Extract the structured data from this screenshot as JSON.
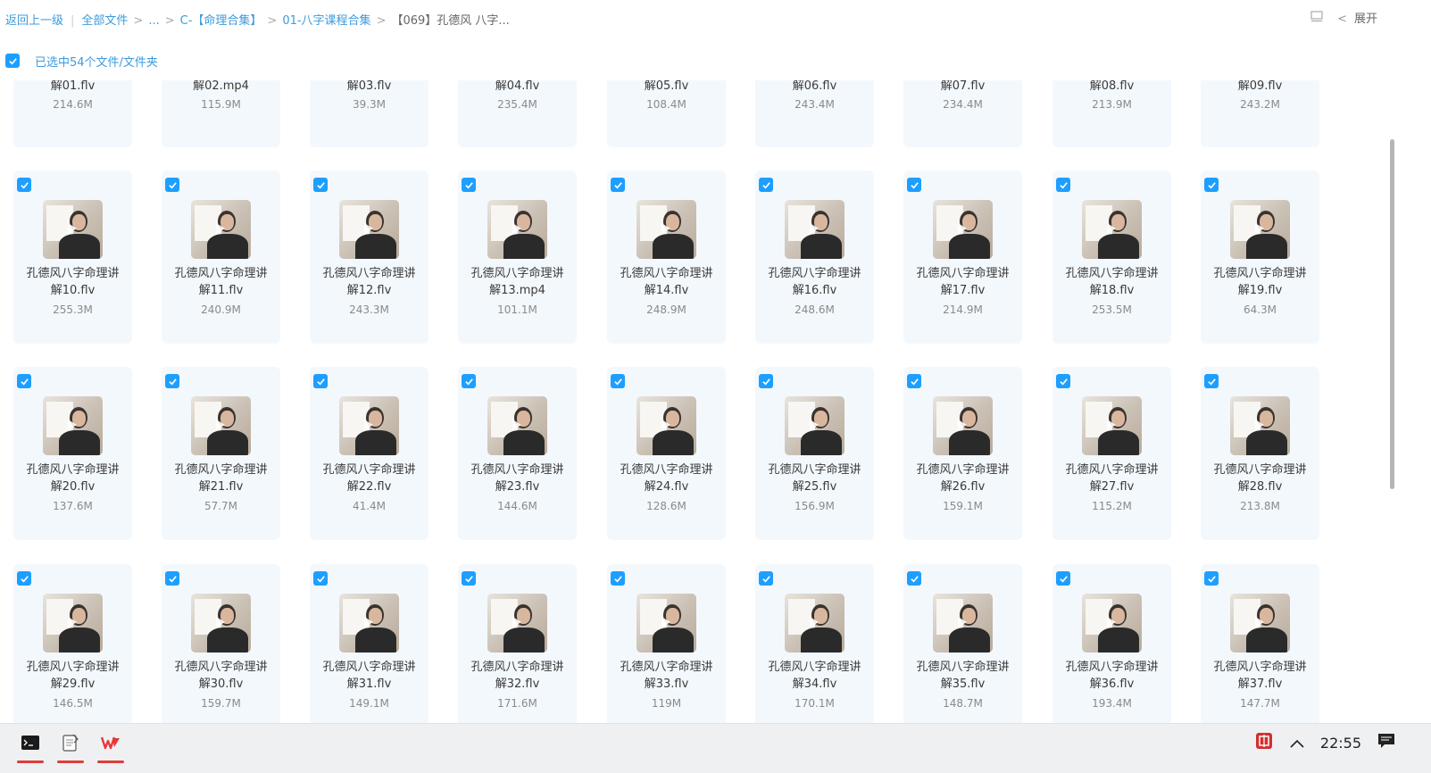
{
  "breadcrumb": {
    "back": "返回上一级",
    "all_files": "全部文件",
    "ellipsis": "...",
    "folder1": "C-【命理合集】",
    "folder2": "01-八字课程合集",
    "current": "【069】孔德风 八字..."
  },
  "header": {
    "expand_label": "展开"
  },
  "selection": {
    "text": "已选中54个文件/文件夹"
  },
  "colors": {
    "accent": "#1e9fff",
    "link": "#3d9bdc",
    "tile_bg": "#f3f8fd",
    "taskbar_bg": "#eff0f2"
  },
  "top_row": [
    {
      "name": "解01.flv",
      "size": "214.6M"
    },
    {
      "name": "解02.mp4",
      "size": "115.9M"
    },
    {
      "name": "解03.flv",
      "size": "39.3M"
    },
    {
      "name": "解04.flv",
      "size": "235.4M"
    },
    {
      "name": "解05.flv",
      "size": "108.4M"
    },
    {
      "name": "解06.flv",
      "size": "243.4M"
    },
    {
      "name": "解07.flv",
      "size": "234.4M"
    },
    {
      "name": "解08.flv",
      "size": "213.9M"
    },
    {
      "name": "解09.flv",
      "size": "243.2M"
    }
  ],
  "file_prefix": "孔德风八字命理讲",
  "rows": [
    [
      {
        "name": "解10.flv",
        "size": "255.3M"
      },
      {
        "name": "解11.flv",
        "size": "240.9M"
      },
      {
        "name": "解12.flv",
        "size": "243.3M"
      },
      {
        "name": "解13.mp4",
        "size": "101.1M"
      },
      {
        "name": "解14.flv",
        "size": "248.9M"
      },
      {
        "name": "解16.flv",
        "size": "248.6M"
      },
      {
        "name": "解17.flv",
        "size": "214.9M"
      },
      {
        "name": "解18.flv",
        "size": "253.5M"
      },
      {
        "name": "解19.flv",
        "size": "64.3M"
      }
    ],
    [
      {
        "name": "解20.flv",
        "size": "137.6M"
      },
      {
        "name": "解21.flv",
        "size": "57.7M"
      },
      {
        "name": "解22.flv",
        "size": "41.4M"
      },
      {
        "name": "解23.flv",
        "size": "144.6M"
      },
      {
        "name": "解24.flv",
        "size": "128.6M"
      },
      {
        "name": "解25.flv",
        "size": "156.9M"
      },
      {
        "name": "解26.flv",
        "size": "159.1M"
      },
      {
        "name": "解27.flv",
        "size": "115.2M"
      },
      {
        "name": "解28.flv",
        "size": "213.8M"
      }
    ],
    [
      {
        "name": "解29.flv",
        "size": "146.5M"
      },
      {
        "name": "解30.flv",
        "size": "159.7M"
      },
      {
        "name": "解31.flv",
        "size": "149.1M"
      },
      {
        "name": "解32.flv",
        "size": "171.6M"
      },
      {
        "name": "解33.flv",
        "size": "119M"
      },
      {
        "name": "解34.flv",
        "size": "170.1M"
      },
      {
        "name": "解35.flv",
        "size": "148.7M"
      },
      {
        "name": "解36.flv",
        "size": "193.4M"
      },
      {
        "name": "解37.flv",
        "size": "147.7M"
      }
    ]
  ],
  "taskbar": {
    "apps": [
      "terminal-icon",
      "notepad-icon",
      "wps-icon"
    ],
    "time": "22:55"
  }
}
